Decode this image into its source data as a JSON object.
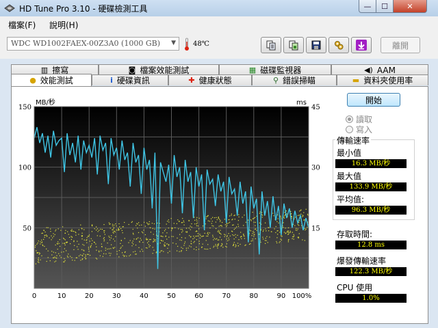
{
  "window": {
    "title": "HD Tune Pro 3.10 - 硬碟檢測工具",
    "controls": {
      "minimize": "—",
      "maximize": "☐",
      "close": "✕"
    }
  },
  "menu": {
    "items": [
      {
        "label": "檔案(F)"
      },
      {
        "label": "說明(H)"
      }
    ]
  },
  "toolbar": {
    "drive": "WDC WD1002FAEX-00Z3A0 (1000 GB)",
    "temperature": "48℃",
    "exit_label": "離開",
    "buttons": [
      "copy-text-icon",
      "copy-screenshot-icon",
      "save-icon",
      "options-icon",
      "download-icon"
    ]
  },
  "tabs": {
    "top": [
      {
        "label": "擦寫",
        "icon": "eraser-icon"
      },
      {
        "label": "檔案效能測試",
        "icon": "file-benchmark-icon"
      },
      {
        "label": "磁碟監視器",
        "icon": "disk-monitor-icon"
      },
      {
        "label": "AAM",
        "icon": "speaker-icon"
      }
    ],
    "bottom": [
      {
        "label": "效能測試",
        "icon": "benchmark-icon",
        "active": true
      },
      {
        "label": "硬碟資訊",
        "icon": "info-icon"
      },
      {
        "label": "健康狀態",
        "icon": "health-cross-icon"
      },
      {
        "label": "錯誤掃瞄",
        "icon": "magnifier-icon"
      },
      {
        "label": "資料夾使用率",
        "icon": "folder-icon"
      }
    ]
  },
  "benchmark": {
    "start_label": "開始",
    "mode_read": "讀取",
    "mode_write": "寫入",
    "selected_mode": "讀取",
    "transfer_rate_title": "傳輸速率",
    "min_label": "最小值",
    "min_value": "16.3 MB/秒",
    "max_label": "最大值",
    "max_value": "133.9 MB/秒",
    "avg_label": "平均值:",
    "avg_value": "96.3 MB/秒",
    "access_time_label": "存取時間:",
    "access_time_value": "12.8 ms",
    "burst_rate_label": "爆發傳輸速率",
    "burst_rate_value": "122.3 MB/秒",
    "cpu_label": "CPU 使用",
    "cpu_value": "1.0%"
  },
  "colors": {
    "transfer_line": "#3fc6e6",
    "access_points": "#e4e43a",
    "plot_bg_top": "#000000",
    "plot_bg_bottom": "#555555"
  },
  "chart_data": {
    "type": "line",
    "ylabel_left": "MB/秒",
    "ylabel_right": "ms",
    "ylim_left": [
      0,
      150
    ],
    "ylim_right": [
      0,
      45
    ],
    "xlim": [
      0,
      100
    ],
    "x_ticks": [
      "0",
      "10",
      "20",
      "30",
      "40",
      "50",
      "60",
      "70",
      "80",
      "90",
      "100%"
    ],
    "y_ticks_left": [
      "150",
      "100",
      "50"
    ],
    "y_ticks_right": [
      "45",
      "30",
      "15"
    ],
    "grid": true,
    "series": [
      {
        "kind": "transfer_rate",
        "x": [
          0,
          1,
          2,
          3,
          4,
          5,
          6,
          7,
          8,
          9,
          10,
          11,
          12,
          13,
          14,
          15,
          16,
          17,
          18,
          19,
          20,
          21,
          22,
          23,
          24,
          25,
          26,
          27,
          28,
          29,
          30,
          31,
          32,
          33,
          34,
          35,
          36,
          37,
          38,
          39,
          40,
          41,
          42,
          43,
          44,
          45,
          46,
          47,
          48,
          49,
          50,
          51,
          52,
          53,
          54,
          55,
          56,
          57,
          58,
          59,
          60,
          61,
          62,
          63,
          64,
          65,
          66,
          67,
          68,
          69,
          70,
          71,
          72,
          73,
          74,
          75,
          76,
          77,
          78,
          79,
          80,
          81,
          82,
          83,
          84,
          85,
          86,
          87,
          88,
          89,
          90,
          91,
          92,
          93,
          94,
          95,
          96,
          97,
          98,
          99,
          100
        ],
        "y": [
          124,
          133,
          120,
          128,
          112,
          126,
          108,
          130,
          118,
          122,
          124,
          96,
          128,
          110,
          120,
          104,
          126,
          98,
          122,
          112,
          118,
          108,
          124,
          94,
          126,
          114,
          120,
          86,
          124,
          110,
          116,
          98,
          122,
          106,
          112,
          84,
          120,
          104,
          110,
          78,
          116,
          98,
          106,
          66,
          112,
          16,
          104,
          96,
          88,
          102,
          70,
          110,
          92,
          100,
          62,
          106,
          88,
          96,
          58,
          100,
          84,
          94,
          48,
          98,
          86,
          90,
          68,
          94,
          80,
          88,
          54,
          92,
          78,
          82,
          60,
          88,
          70,
          80,
          38,
          84,
          66,
          74,
          28,
          80,
          60,
          72,
          50,
          76,
          56,
          68,
          44,
          70,
          58,
          66,
          50,
          64,
          54,
          60,
          48,
          58,
          50
        ]
      },
      {
        "kind": "access_time",
        "n_points": 900,
        "y_range_ms_start": [
          6,
          15
        ],
        "y_range_ms_end": [
          12,
          20
        ]
      }
    ]
  }
}
